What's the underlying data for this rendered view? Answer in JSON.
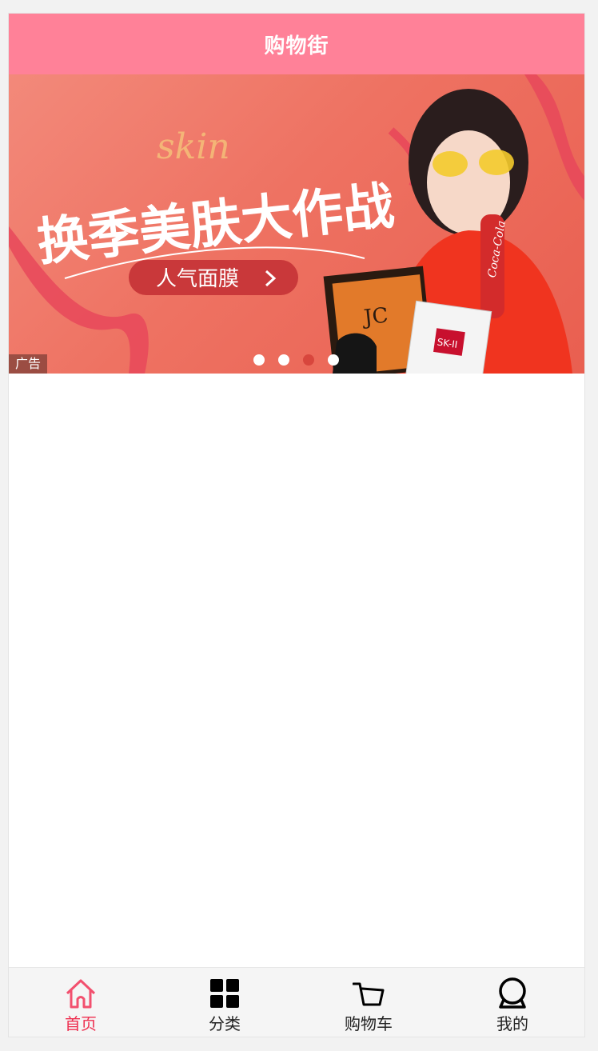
{
  "header": {
    "title": "购物街",
    "background": "#ff8198"
  },
  "banner": {
    "headline": "换季美肤大作战",
    "script_text": "skin",
    "cta_label": "人气面膜",
    "ad_label": "广告",
    "product_labels": [
      "JC",
      "SK-II",
      "Coca-Cola"
    ],
    "dots_count": 4,
    "active_dot_index": 2,
    "accent_color": "#d8463d"
  },
  "tabbar": {
    "items": [
      {
        "label": "首页",
        "icon": "home-icon",
        "active": true
      },
      {
        "label": "分类",
        "icon": "category-grid-icon",
        "active": false
      },
      {
        "label": "购物车",
        "icon": "cart-icon",
        "active": false
      },
      {
        "label": "我的",
        "icon": "profile-icon",
        "active": false
      }
    ],
    "active_color": "#ee2e4f"
  }
}
